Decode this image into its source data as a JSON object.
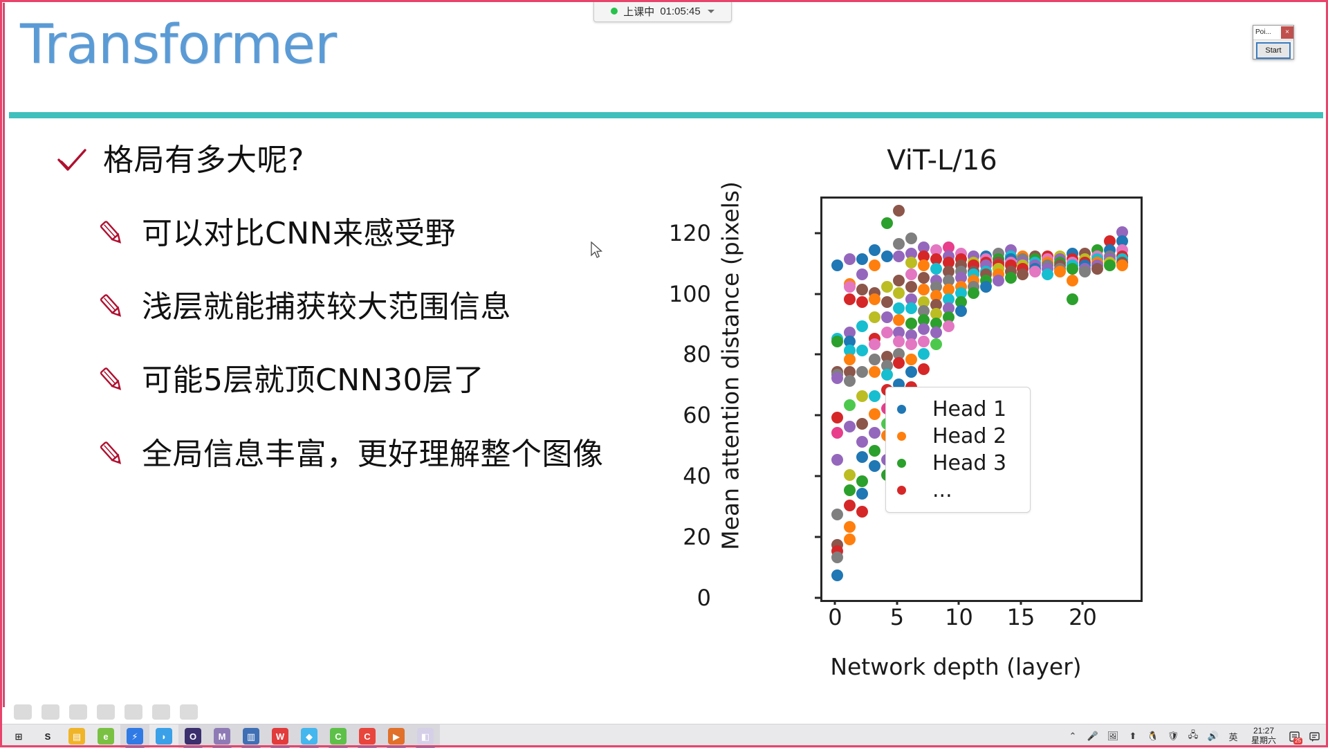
{
  "status_pill": {
    "label": "上课中",
    "timer": "01:05:45",
    "dot_color": "#27c24c",
    "chevron_icon": "chevron-down-icon"
  },
  "poi_window": {
    "title": "Poi...",
    "close_label": "×",
    "start_label": "Start",
    "close_color": "#c0504d",
    "start_border_color": "#3a7bbf"
  },
  "slide": {
    "title": "Transformer",
    "title_color": "#5b9bd5",
    "rule_color": "#3fc0bd",
    "accent_red": "#b01030",
    "bullets": [
      {
        "icon": "check-mark-icon",
        "text": "格局有多大呢?",
        "level": 0
      },
      {
        "icon": "pencil-icon",
        "text": "可以对比CNN来感受野",
        "level": 1
      },
      {
        "icon": "pencil-icon",
        "text": "浅层就能捕获较大范围信息",
        "level": 1
      },
      {
        "icon": "pencil-icon",
        "text": "可能5层就顶CNN30层了",
        "level": 1
      },
      {
        "icon": "pencil-icon",
        "text": "全局信息丰富，更好理解整个图像",
        "level": 1
      }
    ]
  },
  "chart_data": {
    "type": "scatter",
    "title": "ViT-L/16",
    "xlabel": "Network depth (layer)",
    "ylabel": "Mean attention distance (pixels)",
    "xlim": [
      -1.2,
      24.5
    ],
    "ylim": [
      0,
      132
    ],
    "xticks": [
      0,
      5,
      10,
      15,
      20
    ],
    "yticks": [
      0,
      20,
      40,
      60,
      80,
      100,
      120
    ],
    "grid": false,
    "legend_position": "lower right",
    "legend": [
      {
        "label": "Head 1",
        "color": "#1f77b4"
      },
      {
        "label": "Head 2",
        "color": "#ff7f0e"
      },
      {
        "label": "Head 3",
        "color": "#2ca02c"
      },
      {
        "label": "...",
        "color": "#d62728"
      }
    ],
    "series_colors": [
      "#1f77b4",
      "#ff7f0e",
      "#2ca02c",
      "#d62728",
      "#9467bd",
      "#8c564b",
      "#e377c2",
      "#7f7f7f",
      "#bcbd22",
      "#17becf",
      "#e83e8c",
      "#4cc94c"
    ],
    "points": [
      [
        0,
        110,
        0
      ],
      [
        0,
        86,
        9
      ],
      [
        0,
        85,
        2
      ],
      [
        0,
        75,
        5
      ],
      [
        0,
        74,
        7
      ],
      [
        0,
        73,
        4
      ],
      [
        0,
        60,
        3
      ],
      [
        0,
        55,
        10
      ],
      [
        0,
        46,
        4
      ],
      [
        0,
        28,
        7
      ],
      [
        0,
        18,
        5
      ],
      [
        0,
        16,
        3
      ],
      [
        0,
        14,
        7
      ],
      [
        0,
        8,
        0
      ],
      [
        1,
        112,
        4
      ],
      [
        1,
        104,
        1
      ],
      [
        1,
        103,
        6
      ],
      [
        1,
        99,
        3
      ],
      [
        1,
        88,
        4
      ],
      [
        1,
        85,
        0
      ],
      [
        1,
        82,
        9
      ],
      [
        1,
        79,
        1
      ],
      [
        1,
        75,
        5
      ],
      [
        1,
        72,
        7
      ],
      [
        1,
        64,
        11
      ],
      [
        1,
        57,
        4
      ],
      [
        1,
        41,
        8
      ],
      [
        1,
        36,
        2
      ],
      [
        1,
        31,
        3
      ],
      [
        1,
        24,
        1
      ],
      [
        1,
        20,
        1
      ],
      [
        2,
        112,
        0
      ],
      [
        2,
        107,
        4
      ],
      [
        2,
        102,
        5
      ],
      [
        2,
        98,
        3
      ],
      [
        2,
        90,
        9
      ],
      [
        2,
        82,
        9
      ],
      [
        2,
        75,
        7
      ],
      [
        2,
        67,
        8
      ],
      [
        2,
        58,
        5
      ],
      [
        2,
        52,
        4
      ],
      [
        2,
        47,
        0
      ],
      [
        2,
        39,
        2
      ],
      [
        2,
        35,
        0
      ],
      [
        2,
        29,
        3
      ],
      [
        3,
        115,
        0
      ],
      [
        3,
        110,
        1
      ],
      [
        3,
        101,
        5
      ],
      [
        3,
        99,
        1
      ],
      [
        3,
        93,
        8
      ],
      [
        3,
        86,
        3
      ],
      [
        3,
        84,
        6
      ],
      [
        3,
        79,
        7
      ],
      [
        3,
        75,
        1
      ],
      [
        3,
        67,
        9
      ],
      [
        3,
        61,
        1
      ],
      [
        3,
        55,
        4
      ],
      [
        3,
        49,
        2
      ],
      [
        3,
        44,
        0
      ],
      [
        4,
        124,
        2
      ],
      [
        4,
        113,
        0
      ],
      [
        4,
        103,
        8
      ],
      [
        4,
        98,
        5
      ],
      [
        4,
        93,
        4
      ],
      [
        4,
        88,
        6
      ],
      [
        4,
        80,
        5
      ],
      [
        4,
        77,
        7
      ],
      [
        4,
        74,
        9
      ],
      [
        4,
        69,
        3
      ],
      [
        4,
        63,
        10
      ],
      [
        4,
        58,
        11
      ],
      [
        4,
        54,
        1
      ],
      [
        4,
        46,
        4
      ],
      [
        4,
        41,
        2
      ],
      [
        5,
        128,
        5
      ],
      [
        5,
        117,
        7
      ],
      [
        5,
        113,
        4
      ],
      [
        5,
        105,
        5
      ],
      [
        5,
        101,
        8
      ],
      [
        5,
        96,
        9
      ],
      [
        5,
        92,
        1
      ],
      [
        5,
        88,
        4
      ],
      [
        5,
        85,
        6
      ],
      [
        5,
        81,
        7
      ],
      [
        5,
        78,
        3
      ],
      [
        5,
        71,
        0
      ],
      [
        5,
        68,
        3
      ],
      [
        5,
        61,
        9
      ],
      [
        6,
        119,
        7
      ],
      [
        6,
        114,
        4
      ],
      [
        6,
        111,
        8
      ],
      [
        6,
        107,
        6
      ],
      [
        6,
        103,
        5
      ],
      [
        6,
        99,
        4
      ],
      [
        6,
        96,
        9
      ],
      [
        6,
        91,
        2
      ],
      [
        6,
        87,
        4
      ],
      [
        6,
        84,
        6
      ],
      [
        6,
        79,
        1
      ],
      [
        6,
        75,
        0
      ],
      [
        6,
        70,
        3
      ],
      [
        7,
        116,
        4
      ],
      [
        7,
        113,
        3
      ],
      [
        7,
        110,
        1
      ],
      [
        7,
        106,
        5
      ],
      [
        7,
        102,
        1
      ],
      [
        7,
        98,
        8
      ],
      [
        7,
        95,
        7
      ],
      [
        7,
        92,
        2
      ],
      [
        7,
        89,
        4
      ],
      [
        7,
        85,
        6
      ],
      [
        7,
        81,
        9
      ],
      [
        7,
        76,
        3
      ],
      [
        8,
        115,
        6
      ],
      [
        8,
        112,
        3
      ],
      [
        8,
        109,
        9
      ],
      [
        8,
        105,
        4
      ],
      [
        8,
        103,
        7
      ],
      [
        8,
        100,
        1
      ],
      [
        8,
        97,
        5
      ],
      [
        8,
        94,
        8
      ],
      [
        8,
        91,
        2
      ],
      [
        8,
        88,
        4
      ],
      [
        8,
        84,
        11
      ],
      [
        9,
        116,
        10
      ],
      [
        9,
        113,
        4
      ],
      [
        9,
        111,
        3
      ],
      [
        9,
        108,
        5
      ],
      [
        9,
        105,
        7
      ],
      [
        9,
        102,
        1
      ],
      [
        9,
        99,
        9
      ],
      [
        9,
        96,
        4
      ],
      [
        9,
        93,
        2
      ],
      [
        9,
        90,
        6
      ],
      [
        10,
        114,
        6
      ],
      [
        10,
        112,
        3
      ],
      [
        10,
        110,
        5
      ],
      [
        10,
        108,
        7
      ],
      [
        10,
        106,
        4
      ],
      [
        10,
        103,
        1
      ],
      [
        10,
        101,
        9
      ],
      [
        10,
        98,
        2
      ],
      [
        10,
        95,
        0
      ],
      [
        11,
        113,
        4
      ],
      [
        11,
        111,
        8
      ],
      [
        11,
        110,
        3
      ],
      [
        11,
        108,
        5
      ],
      [
        11,
        107,
        9
      ],
      [
        11,
        105,
        1
      ],
      [
        11,
        103,
        7
      ],
      [
        11,
        101,
        2
      ],
      [
        12,
        113,
        0
      ],
      [
        12,
        112,
        6
      ],
      [
        12,
        111,
        3
      ],
      [
        12,
        110,
        4
      ],
      [
        12,
        108,
        9
      ],
      [
        12,
        107,
        5
      ],
      [
        12,
        105,
        2
      ],
      [
        12,
        103,
        0
      ],
      [
        13,
        114,
        7
      ],
      [
        13,
        112,
        2
      ],
      [
        13,
        111,
        5
      ],
      [
        13,
        110,
        3
      ],
      [
        13,
        109,
        8
      ],
      [
        13,
        107,
        1
      ],
      [
        13,
        105,
        4
      ],
      [
        14,
        115,
        4
      ],
      [
        14,
        113,
        9
      ],
      [
        14,
        112,
        0
      ],
      [
        14,
        111,
        6
      ],
      [
        14,
        110,
        3
      ],
      [
        14,
        108,
        5
      ],
      [
        14,
        106,
        2
      ],
      [
        15,
        113,
        1
      ],
      [
        15,
        112,
        7
      ],
      [
        15,
        111,
        4
      ],
      [
        15,
        110,
        8
      ],
      [
        15,
        109,
        3
      ],
      [
        15,
        107,
        5
      ],
      [
        16,
        113,
        5
      ],
      [
        16,
        112,
        2
      ],
      [
        16,
        111,
        9
      ],
      [
        16,
        110,
        4
      ],
      [
        16,
        109,
        0
      ],
      [
        16,
        108,
        6
      ],
      [
        17,
        113,
        3
      ],
      [
        17,
        112,
        6
      ],
      [
        17,
        111,
        1
      ],
      [
        17,
        110,
        7
      ],
      [
        17,
        109,
        4
      ],
      [
        17,
        107,
        9
      ],
      [
        18,
        113,
        8
      ],
      [
        18,
        112,
        4
      ],
      [
        18,
        111,
        2
      ],
      [
        18,
        110,
        5
      ],
      [
        18,
        109,
        7
      ],
      [
        18,
        108,
        1
      ],
      [
        19,
        114,
        0
      ],
      [
        19,
        112,
        3
      ],
      [
        19,
        111,
        6
      ],
      [
        19,
        110,
        9
      ],
      [
        19,
        109,
        2
      ],
      [
        19,
        105,
        1
      ],
      [
        19,
        99,
        2
      ],
      [
        20,
        114,
        5
      ],
      [
        20,
        112,
        8
      ],
      [
        20,
        111,
        3
      ],
      [
        20,
        110,
        0
      ],
      [
        20,
        109,
        4
      ],
      [
        20,
        108,
        7
      ],
      [
        21,
        115,
        2
      ],
      [
        21,
        113,
        6
      ],
      [
        21,
        112,
        9
      ],
      [
        21,
        111,
        1
      ],
      [
        21,
        110,
        4
      ],
      [
        21,
        109,
        5
      ],
      [
        22,
        118,
        3
      ],
      [
        22,
        115,
        0
      ],
      [
        22,
        113,
        7
      ],
      [
        22,
        112,
        4
      ],
      [
        22,
        111,
        8
      ],
      [
        22,
        110,
        2
      ],
      [
        23,
        121,
        4
      ],
      [
        23,
        118,
        0
      ],
      [
        23,
        115,
        6
      ],
      [
        23,
        113,
        3
      ],
      [
        23,
        112,
        9
      ],
      [
        23,
        111,
        5
      ],
      [
        23,
        110,
        1
      ]
    ]
  },
  "taskbar": {
    "start_icon": "windows-start-icon",
    "items": [
      {
        "name": "windows-start-icon",
        "glyph": "⊞",
        "color": "#2b2b2b",
        "bg": "transparent",
        "active": false
      },
      {
        "name": "seewo-icon",
        "glyph": "S",
        "color": "#1a1a1a",
        "bg": "transparent",
        "active": false
      },
      {
        "name": "file-explorer-icon",
        "glyph": "▤",
        "color": "#ffffff",
        "bg": "#f0b429",
        "active": false
      },
      {
        "name": "edge-legacy-icon",
        "glyph": "e",
        "color": "#ffffff",
        "bg": "#7ac143",
        "active": false
      },
      {
        "name": "thunder-download-icon",
        "glyph": "⚡",
        "color": "#ffffff",
        "bg": "#2f7ae5",
        "active": true
      },
      {
        "name": "sogou-browser-icon",
        "glyph": "◗",
        "color": "#ffffff",
        "bg": "#3aa0e8",
        "active": false
      },
      {
        "name": "opera-icon",
        "glyph": "O",
        "color": "#ffffff",
        "bg": "#3b2f6e",
        "active": true
      },
      {
        "name": "maya-icon",
        "glyph": "M",
        "color": "#ffffff",
        "bg": "#8e7bb5",
        "active": true
      },
      {
        "name": "notes-app-icon",
        "glyph": "▥",
        "color": "#ffffff",
        "bg": "#3f6fb5",
        "active": true
      },
      {
        "name": "wps-writer-icon",
        "glyph": "W",
        "color": "#ffffff",
        "bg": "#e23b3b",
        "active": true
      },
      {
        "name": "everything-search-icon",
        "glyph": "◆",
        "color": "#ffffff",
        "bg": "#43b7ee",
        "active": true
      },
      {
        "name": "wechat-icon",
        "glyph": "C",
        "color": "#ffffff",
        "bg": "#5ec049",
        "active": true
      },
      {
        "name": "camtasia-icon",
        "glyph": "C",
        "color": "#ffffff",
        "bg": "#e8453c",
        "active": true
      },
      {
        "name": "pdf-reader-icon",
        "glyph": "▶",
        "color": "#ffffff",
        "bg": "#e0702a",
        "active": true
      },
      {
        "name": "ppt-presentation-icon",
        "glyph": "◧",
        "color": "#ffffff",
        "bg": "#d6cfe8",
        "active": true
      }
    ],
    "tray": [
      {
        "name": "show-hidden-icons-icon",
        "glyph": "⌃"
      },
      {
        "name": "microphone-icon",
        "glyph": "🎤"
      },
      {
        "name": "screen-capture-icon",
        "glyph": "🖼"
      },
      {
        "name": "update-icon",
        "glyph": "⬆"
      },
      {
        "name": "qq-icon",
        "glyph": "🐧"
      },
      {
        "name": "security-shield-icon",
        "glyph": "🛡"
      },
      {
        "name": "network-icon",
        "glyph": "🖧"
      },
      {
        "name": "volume-icon",
        "glyph": "🔊"
      },
      {
        "name": "ime-language-icon",
        "glyph": "英"
      }
    ],
    "clock_time": "21:27",
    "clock_day": "星期六",
    "notification_badge": "25",
    "notification_icon": "notification-icon",
    "action-center_icon": "action-center-icon"
  }
}
